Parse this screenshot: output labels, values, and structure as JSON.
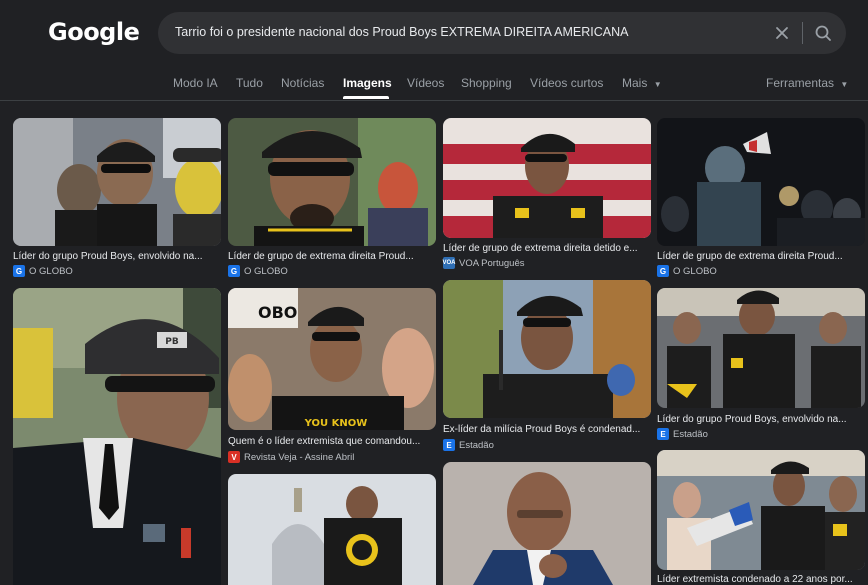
{
  "logo": "Google",
  "search": {
    "query": "Tarrio foi o presidente nacional dos Proud Boys EXTREMA DIREITA AMERICANA"
  },
  "tabs": [
    "Modo IA",
    "Tudo",
    "Notícias",
    "Imagens",
    "Vídeos",
    "Shopping",
    "Vídeos curtos",
    "Mais"
  ],
  "tools_label": "Ferramentas",
  "results": [
    {
      "caption": "Líder do grupo Proud Boys, envolvido na...",
      "source": "O GLOBO",
      "favicon": "google-g-icon"
    },
    {
      "caption": "Líder de grupo de extrema direita Proud...",
      "source": "O GLOBO",
      "favicon": "google-g-icon"
    },
    {
      "caption": "Líder de grupo de extrema direita detido e...",
      "source": "VOA Português",
      "favicon": "voa-icon"
    },
    {
      "caption": "Líder de grupo de extrema direita Proud...",
      "source": "O GLOBO",
      "favicon": "google-g-icon"
    },
    {
      "caption": "Quem é o líder extremista que comandou...",
      "source": "Revista Veja - Assine Abril",
      "favicon": "veja-icon"
    },
    {
      "caption": "Ex-líder da milícia Proud Boys é condenad...",
      "source": "Estadão",
      "favicon": "estadao-icon"
    },
    {
      "caption": "Líder do grupo Proud Boys, envolvido na...",
      "source": "Estadão",
      "favicon": "estadao-icon"
    },
    {
      "caption": "Líder extremista condenado a 22 anos por...",
      "source": "",
      "favicon": ""
    }
  ],
  "image_text": {
    "cap_badge": "PB",
    "shirt_text": "YOU KNOW",
    "sign_text": "OBO"
  },
  "colors": {
    "background": "#202124",
    "search_bg": "#303134",
    "text": "#e8eaed",
    "muted": "#9aa0a6",
    "accent_yellow": "#e8c21b"
  }
}
